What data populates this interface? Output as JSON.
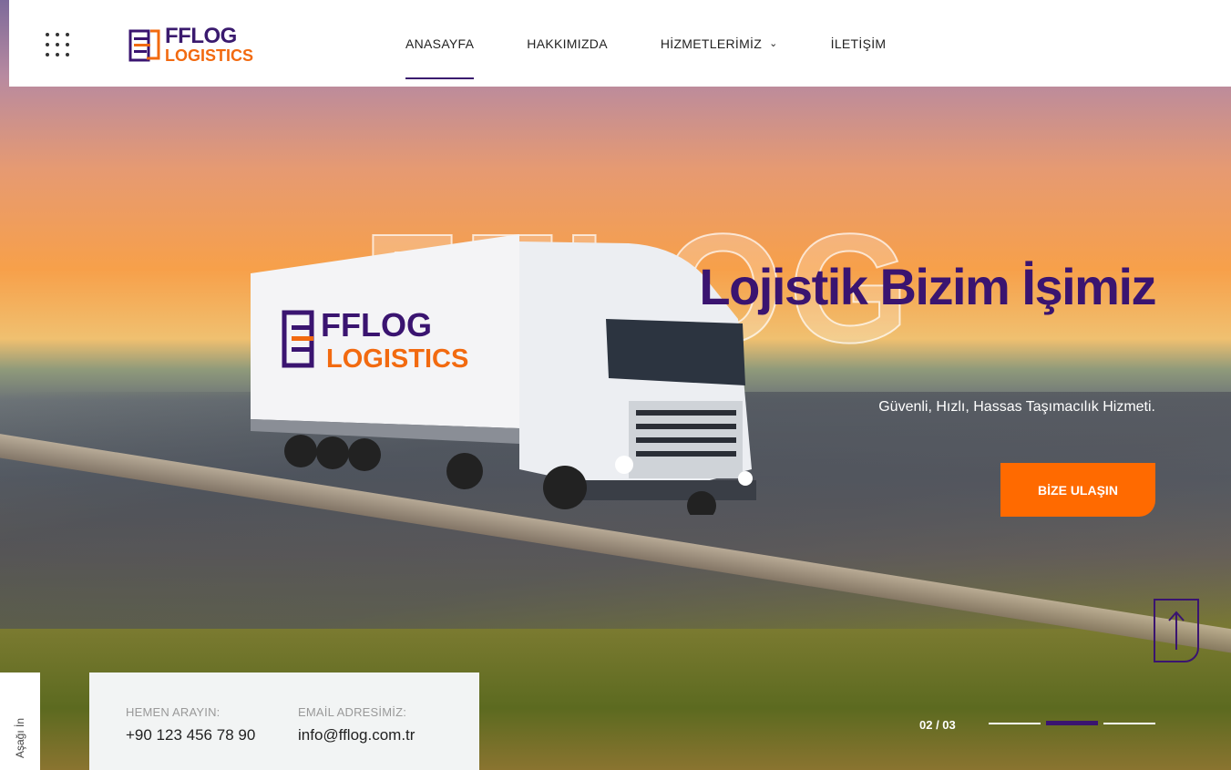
{
  "header": {
    "logo_top": "FFLOG",
    "logo_bottom": "LOGISTICS",
    "nav": [
      {
        "label": "ANASAYFA"
      },
      {
        "label": "HAKKIMIZDA"
      },
      {
        "label": "HİZMETLERİMİZ"
      },
      {
        "label": "İLETİŞİM"
      }
    ]
  },
  "hero": {
    "ghost_text": "FFLOG",
    "title": "Lojistik Bizim İşimiz",
    "subtitle": "Güvenli, Hızlı, Hassas Taşımacılık Hizmeti.",
    "cta": "BİZE ULAŞIN",
    "truck_logo_top": "FFLOG",
    "truck_logo_bottom": "LOGISTICS"
  },
  "slider": {
    "counter": "02 / 03",
    "current": 2,
    "total": 3
  },
  "scroll_down": "Aşağı İn",
  "contact": {
    "phone_label": "HEMEN ARAYIN:",
    "phone": "+90 123 456 78 90",
    "email_label": "EMAİL ADRESİMİZ:",
    "email": "info@fflog.com.tr"
  },
  "colors": {
    "brand_purple": "#3a1470",
    "brand_orange": "#ff6a00"
  }
}
